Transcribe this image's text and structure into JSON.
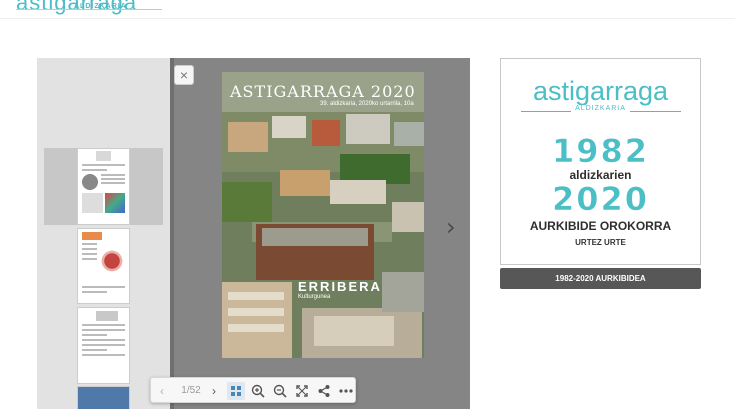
{
  "header": {
    "logo_partial": "astigarraga",
    "logo_sub": "ALDIZKARIA"
  },
  "viewer": {
    "close_icon": "×",
    "next_icon": "›",
    "cover": {
      "title": "ASTIGARRAGA 2020",
      "subtitle": "39. aldizkaria, 2020ko urtarrila, 10a",
      "building_name": "ERRIBERA",
      "building_sub": "Kulturgunea"
    },
    "toolbar": {
      "prev_icon": "‹",
      "page_indicator": "1/52",
      "next_icon": "›",
      "icons": [
        "grid-icon",
        "zoom-in-icon",
        "zoom-out-icon",
        "fullscreen-icon",
        "share-icon",
        "more-icon"
      ]
    }
  },
  "promo": {
    "logo": "astigarraga",
    "logo_sub": "ALDIZKARIA",
    "year_start": "1982",
    "middle": "aldizkarien",
    "year_end": "2020",
    "heading": "AURKIBIDE OROKORRA",
    "subheading": "URTEZ URTE",
    "button_label": "1982-2020 AURKIBIDEA"
  },
  "colors": {
    "brand": "#4bbec6",
    "viewer_bg": "#858585",
    "button_bg": "#575757"
  }
}
